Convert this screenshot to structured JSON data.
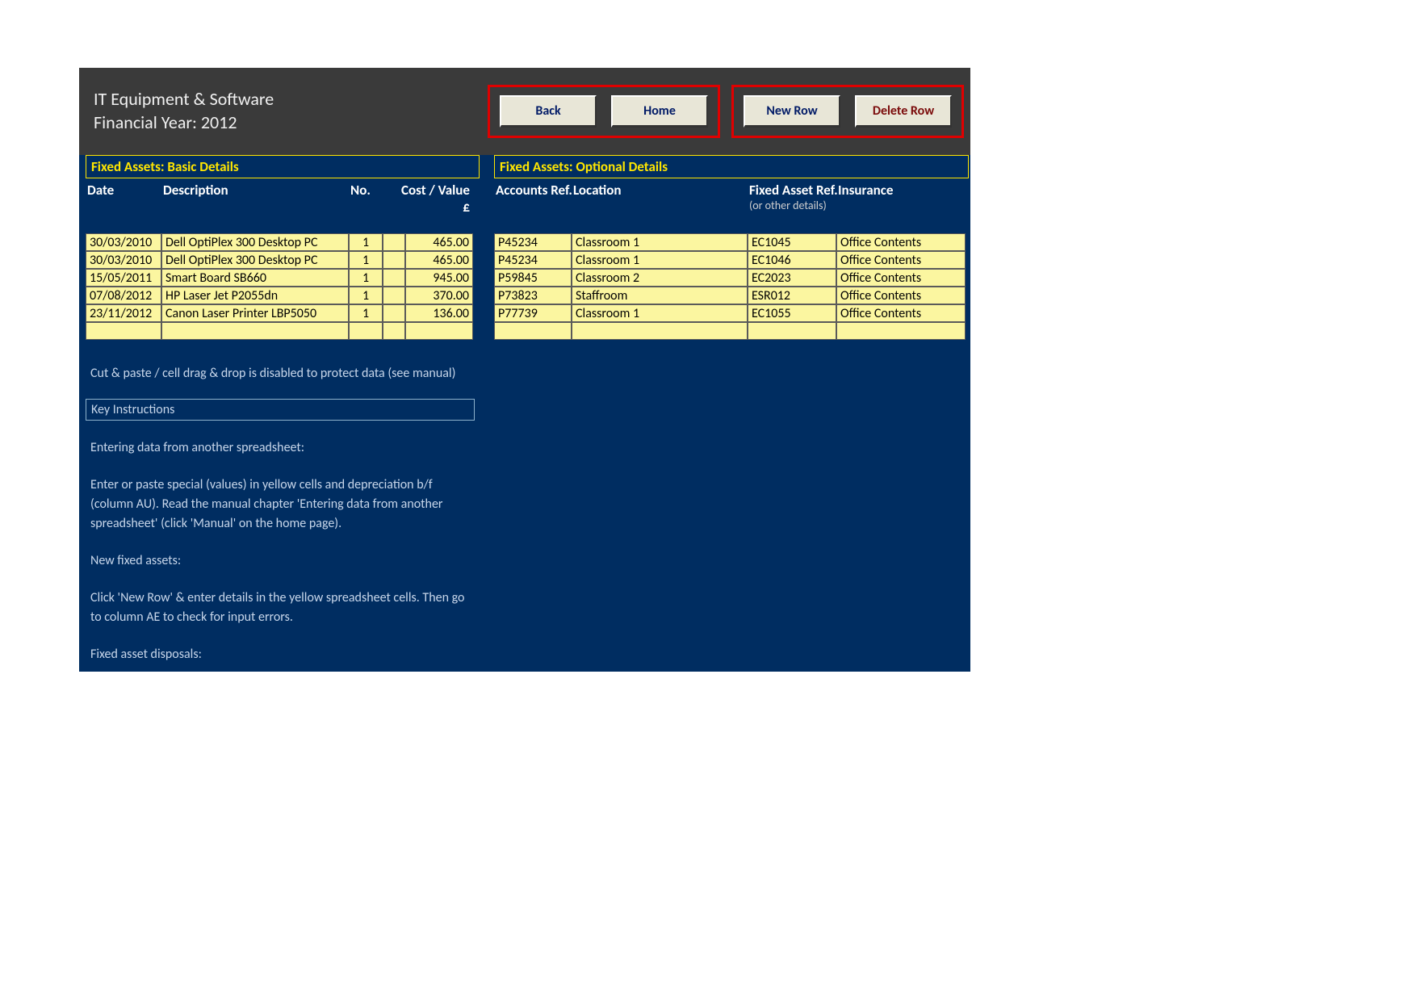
{
  "header": {
    "title_line1": "IT Equipment & Software",
    "title_line2": "Financial Year: 2012",
    "buttons": {
      "back": "Back",
      "home": "Home",
      "new_row": "New Row",
      "delete_row": "Delete Row"
    }
  },
  "panels": {
    "basic": {
      "title": "Fixed Assets: Basic Details",
      "headers": {
        "date": "Date",
        "description": "Description",
        "no": "No.",
        "cost": "Cost / Value",
        "currency": "£"
      }
    },
    "optional": {
      "title": "Fixed Assets: Optional Details",
      "headers": {
        "accounts": "Accounts Ref.",
        "location": "Location",
        "fixed_asset": "Fixed Asset Ref.",
        "fixed_asset_sub": "(or other details)",
        "insurance": "Insurance"
      }
    }
  },
  "rows": [
    {
      "date": "30/03/2010",
      "desc": "Dell OptiPlex 300 Desktop PC",
      "no": "1",
      "cost": "465.00",
      "acc": "P45234",
      "loc": "Classroom 1",
      "ref": "EC1045",
      "ins": "Office Contents"
    },
    {
      "date": "30/03/2010",
      "desc": "Dell OptiPlex 300 Desktop PC",
      "no": "1",
      "cost": "465.00",
      "acc": "P45234",
      "loc": "Classroom 1",
      "ref": "EC1046",
      "ins": "Office Contents"
    },
    {
      "date": "15/05/2011",
      "desc": "Smart Board SB660",
      "no": "1",
      "cost": "945.00",
      "acc": "P59845",
      "loc": "Classroom 2",
      "ref": "EC2023",
      "ins": "Office Contents"
    },
    {
      "date": "07/08/2012",
      "desc": "HP Laser Jet P2055dn",
      "no": "1",
      "cost": "370.00",
      "acc": "P73823",
      "loc": "Staffroom",
      "ref": "ESR012",
      "ins": "Office Contents"
    },
    {
      "date": "23/11/2012",
      "desc": "Canon Laser Printer LBP5050",
      "no": "1",
      "cost": "136.00",
      "acc": "P77739",
      "loc": "Classroom 1",
      "ref": "EC1055",
      "ins": "Office Contents"
    },
    {
      "date": "",
      "desc": "",
      "no": "",
      "cost": "",
      "acc": "",
      "loc": "",
      "ref": "",
      "ins": ""
    }
  ],
  "notes": {
    "protect": "Cut & paste / cell drag & drop is disabled to protect data (see manual)",
    "key_title": "Key Instructions",
    "p1": "Entering data from another spreadsheet:",
    "p2": "Enter or paste special (values) in yellow cells and depreciation b/f (column AU). Read the manual chapter 'Entering data from another spreadsheet' (click 'Manual' on the home page).",
    "p3": "New fixed assets:",
    "p4": "Click 'New Row' & enter details in the yellow spreadsheet cells. Then go to column AE to check for input errors.",
    "p5": "Fixed asset disposals:"
  }
}
